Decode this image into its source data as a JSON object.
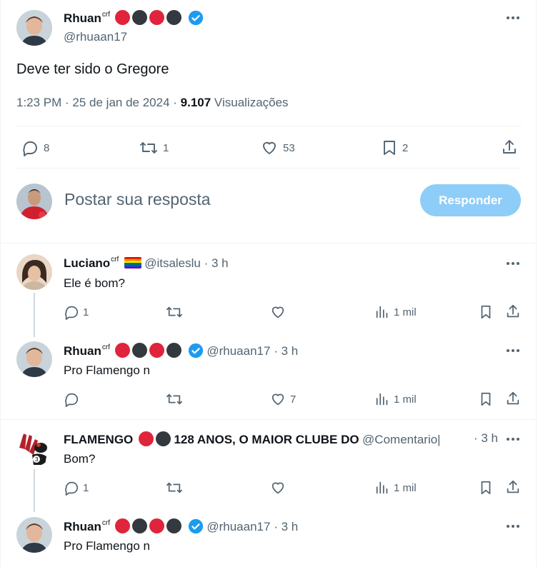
{
  "main_tweet": {
    "name": "Rhuan",
    "name_sup": "crf",
    "handle": "@rhuaan17",
    "text": "Deve ter sido o Gregore",
    "time": "1:23 PM · 25 de jan de 2024 · ",
    "views_count": "9.107",
    "views_label": " Visualizações",
    "actions": {
      "replies": "8",
      "retweets": "1",
      "likes": "53",
      "bookmarks": "2"
    }
  },
  "composer": {
    "placeholder": "Postar sua resposta",
    "button": "Responder",
    "button_color": "#8ecdf8"
  },
  "replies": [
    {
      "name": "Luciano",
      "name_sup": "crf",
      "flag": "rainbow-flag",
      "handle": "@itsaleslu",
      "time": " · 3 h",
      "text": "Ele é bom?",
      "replies": "1",
      "retweets": "",
      "likes": "",
      "views": "1 mil"
    },
    {
      "name": "Rhuan",
      "name_sup": "crf",
      "handle": "@rhuaan17",
      "time": " · 3 h",
      "text": "Pro Flamengo n",
      "replies": "",
      "retweets": "",
      "likes": "7",
      "views": "1 mil"
    },
    {
      "name": "FLAMENGO",
      "name_rest": " 128 ANOS, O MAIOR CLUBE DO",
      "handle": "@Comentario|",
      "time": " · 3 h",
      "text": "Bom?",
      "replies": "1",
      "retweets": "",
      "likes": "",
      "views": "1 mil"
    },
    {
      "name": "Rhuan",
      "name_sup": "crf",
      "handle": "@rhuaan17",
      "time": " · 3 h",
      "text": "Pro Flamengo n"
    }
  ],
  "colors": {
    "verified": "#1d9bf0",
    "badge_red": "#e0243b",
    "badge_dark": "#34383f",
    "muted": "#536471"
  }
}
